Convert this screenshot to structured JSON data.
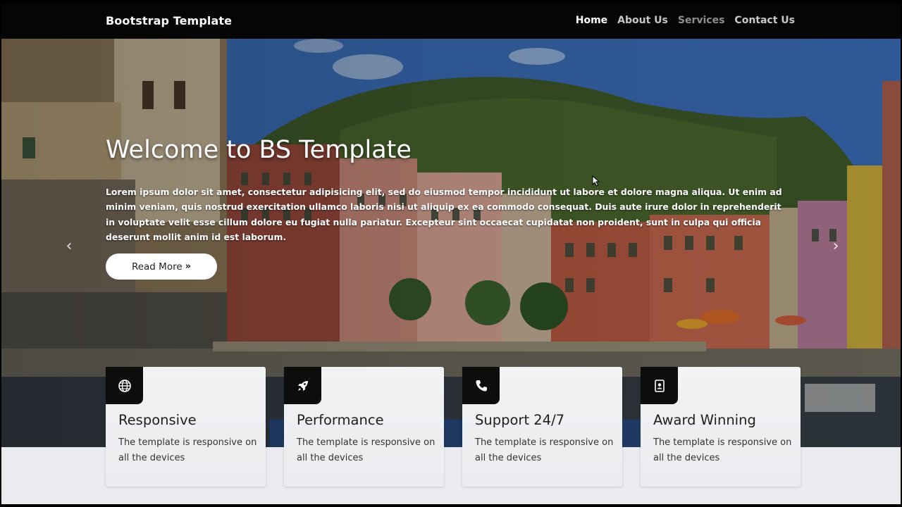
{
  "navbar": {
    "brand": "Bootstrap Template",
    "links": [
      {
        "label": "Home",
        "state": "active"
      },
      {
        "label": "About Us",
        "state": "normal"
      },
      {
        "label": "Services",
        "state": "muted"
      },
      {
        "label": "Contact Us",
        "state": "normal"
      }
    ]
  },
  "hero": {
    "title": "Welcome to BS Template",
    "text": "Lorem ipsum dolor sit amet, consectetur adipisicing elit, sed do eiusmod tempor incididunt ut labore et dolore magna aliqua. Ut enim ad minim veniam, quis nostrud exercitation ullamco laboris nisi ut aliquip ex ea commodo consequat. Duis aute irure dolor in reprehenderit in voluptate velit esse cillum dolore eu fugiat nulla pariatur. Excepteur sint occaecat cupidatat non proident, sunt in culpa qui officia deserunt mollit anim id est laborum.",
    "button_label": "Read More",
    "button_icon": "double-chevron-right-icon",
    "prev_icon": "chevron-left-icon",
    "next_icon": "chevron-right-icon"
  },
  "features": [
    {
      "icon": "globe-icon",
      "title": "Responsive",
      "text": "The template is responsive on all the devices"
    },
    {
      "icon": "rocket-icon",
      "title": "Performance",
      "text": "The template is responsive on all the devices"
    },
    {
      "icon": "phone-icon",
      "title": "Support 24/7",
      "text": "The template is responsive on all the devices"
    },
    {
      "icon": "id-badge-icon",
      "title": "Award Winning",
      "text": "The template is responsive on all the devices"
    }
  ],
  "colors": {
    "navbar_bg": "#050505",
    "nav_active": "#ffffff",
    "nav_normal": "#c8c8c8",
    "nav_muted": "#8f8f8f",
    "card_icon_bg": "#0d0d0d",
    "page_bg": "#e9ebef"
  }
}
